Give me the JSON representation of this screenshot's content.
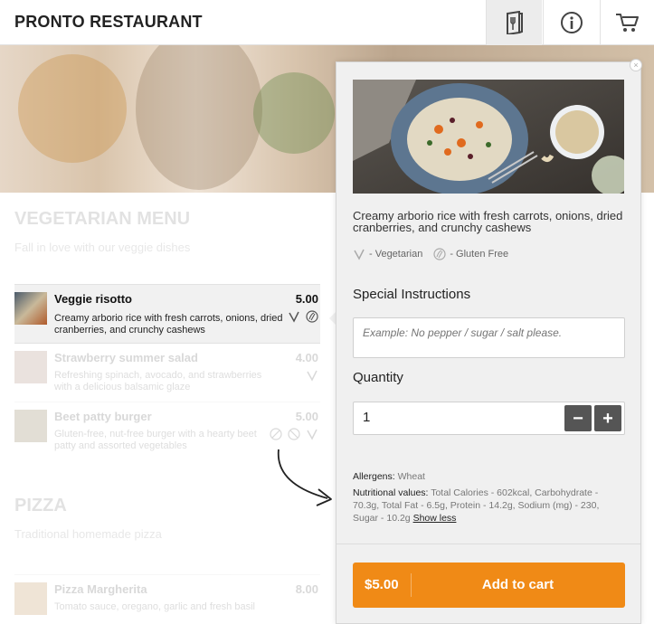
{
  "app": {
    "title": "PRONTO RESTAURANT"
  },
  "header": {
    "buttons": [
      "menu",
      "info",
      "cart"
    ]
  },
  "sections": [
    {
      "title": "VEGETARIAN MENU",
      "subtitle": "Fall in love with our veggie dishes",
      "items": [
        {
          "name": "Veggie risotto",
          "price": "5.00",
          "desc": "Creamy arborio rice with fresh carrots, onions, dried cranberries, and crunchy cashews",
          "icons": [
            "vegetarian-icon",
            "gluten-free-icon"
          ],
          "active": true
        },
        {
          "name": "Strawberry summer salad",
          "price": "4.00",
          "desc": "Refreshing spinach, avocado, and strawberries with a delicious balsamic glaze",
          "icons": [
            "vegetarian-icon"
          ]
        },
        {
          "name": "Beet patty burger",
          "price": "5.00",
          "desc": "Gluten-free, nut-free burger with a hearty beet patty and assorted vegetables",
          "icons": [
            "gluten-free-icon",
            "nut-free-icon",
            "vegetarian-icon"
          ]
        }
      ]
    },
    {
      "title": "PIZZA",
      "subtitle": "Traditional homemade pizza",
      "items": [
        {
          "name": "Pizza Margherita",
          "price": "8.00",
          "desc": "Tomato sauce, oregano, garlic and fresh basil"
        }
      ]
    }
  ],
  "detail": {
    "description": "Creamy arborio rice with fresh carrots, onions, dried cranberries, and crunchy cashews",
    "tags": [
      {
        "icon": "vegetarian-icon",
        "label": "- Vegetarian"
      },
      {
        "icon": "gluten-free-icon",
        "label": "- Gluten Free"
      }
    ],
    "instructions_label": "Special Instructions",
    "instructions_placeholder": "Example: No pepper / sugar / salt please.",
    "quantity_label": "Quantity",
    "quantity_value": "1",
    "minus_label": "−",
    "plus_label": "+",
    "allergens_label": "Allergens:",
    "allergens_value": "Wheat",
    "nutrition_label": "Nutritional values:",
    "nutrition_value": "Total Calories - 602kcal, Carbohydrate - 70.3g, Total Fat - 6.5g, Protein - 14.2g, Sodium (mg) - 230, Sugar - 10.2g",
    "show_less": "Show less",
    "cart_price": "$5.00",
    "cart_label": "Add to cart",
    "close_label": "×"
  },
  "colors": {
    "accent": "#f08a16",
    "stepper": "#555555",
    "panel_bg": "#f0f0f0"
  }
}
